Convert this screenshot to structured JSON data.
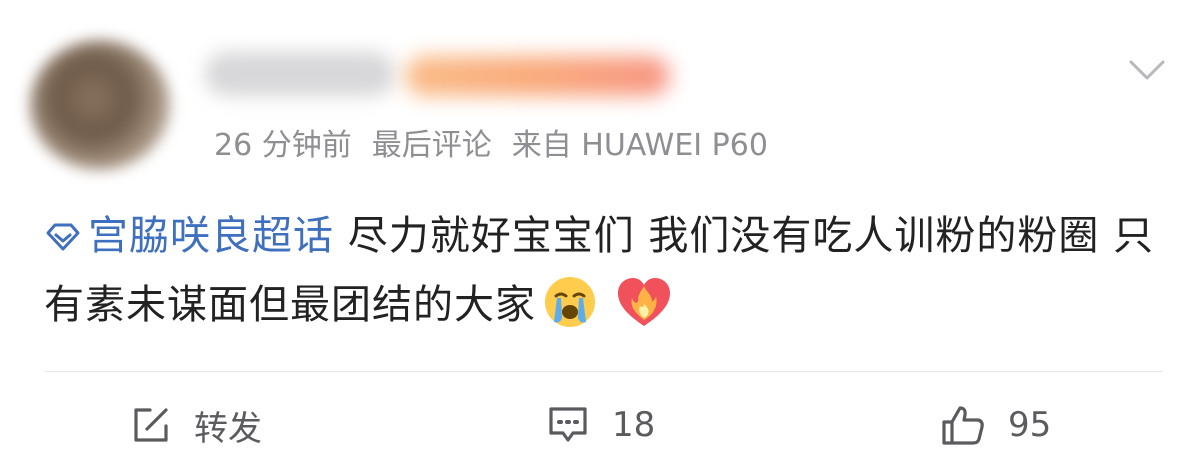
{
  "meta": {
    "time": "26 分钟前",
    "status": "最后评论",
    "source": "来自 HUAWEI P60"
  },
  "content": {
    "topic": "宫脇咲良超话",
    "text": " 尽力就好宝宝们 我们没有吃人训粉的粉圈 只有素未谋面但最团结的大家",
    "emojis": [
      "loudly-crying-face",
      "heart-on-fire"
    ]
  },
  "actions": {
    "repost_label": "转发",
    "comment_count": "18",
    "like_count": "95"
  },
  "colors": {
    "topic": "#3f6fbf",
    "meta": "#8e8e93",
    "text": "#222222",
    "action": "#5b5b5f"
  }
}
